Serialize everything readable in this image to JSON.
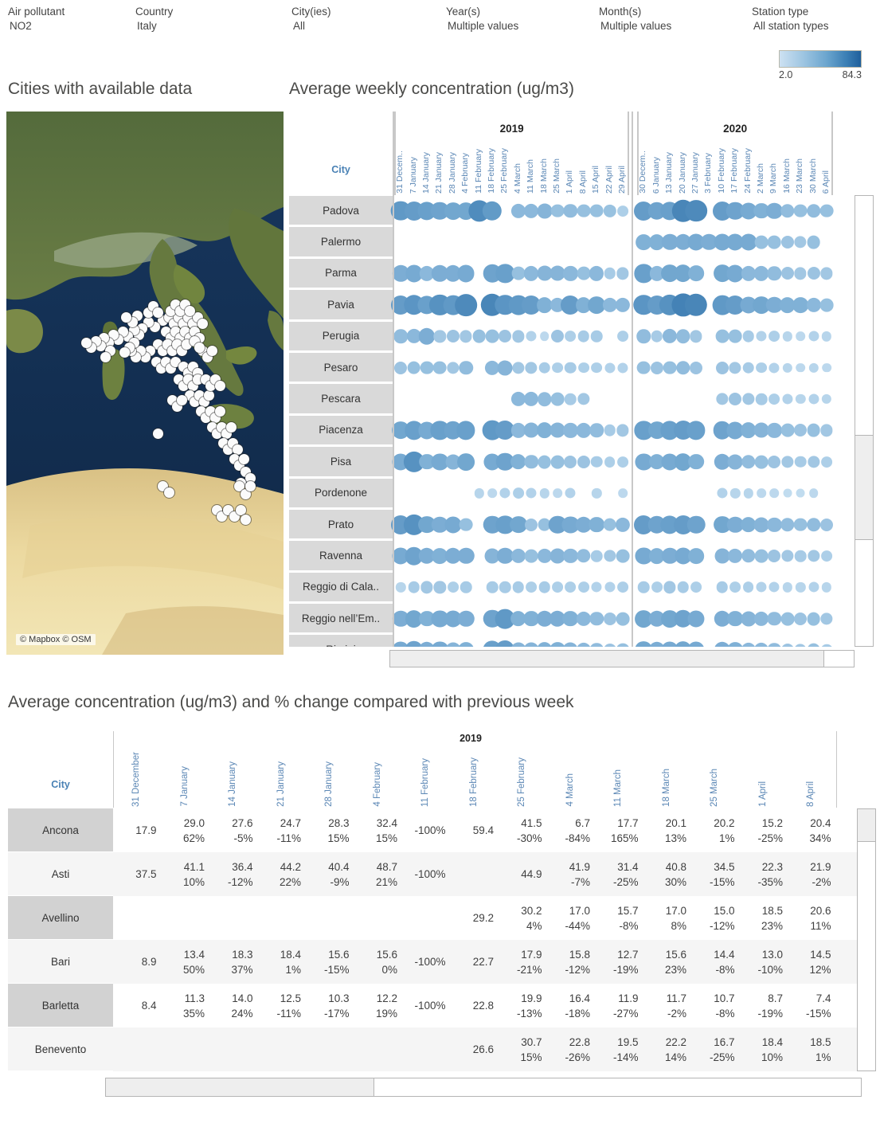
{
  "filters": [
    {
      "label": "Air pollutant",
      "value": "NO2"
    },
    {
      "label": "Country",
      "value": "Italy"
    },
    {
      "label": "City(ies)",
      "value": "All"
    },
    {
      "label": "Year(s)",
      "value": "Multiple values"
    },
    {
      "label": "Month(s)",
      "value": "Multiple values"
    },
    {
      "label": "Station type",
      "value": "All station types"
    }
  ],
  "legend": {
    "min": "2.0",
    "max": "84.3",
    "low_color": "#cde1f2",
    "high_color": "#1f5f9c"
  },
  "map_panel": {
    "title": "Cities with available data",
    "attribution": "© Mapbox © OSM"
  },
  "matrix_panel": {
    "title": "Average weekly concentration  (ug/m3)",
    "city_header": "City",
    "year_groups": [
      {
        "year": "2019",
        "weeks": [
          "31 Decem..",
          "7 January",
          "14 January",
          "21 January",
          "28 January",
          "4 February",
          "11 February",
          "18 February",
          "25 February",
          "4 March",
          "11 March",
          "18 March",
          "25 March",
          "1 April",
          "8 April",
          "15 April",
          "22 April",
          "29 April"
        ]
      },
      {
        "year": "2020",
        "weeks": [
          "30 Decem..",
          "6 January",
          "13 January",
          "20 January",
          "27 January",
          "3 February",
          "10 February",
          "17 February",
          "24 February",
          "2 March",
          "9 March",
          "16 March",
          "23 March",
          "30 March",
          "6 April"
        ]
      }
    ],
    "cities": [
      "Padova",
      "Palermo",
      "Parma",
      "Pavia",
      "Perugia",
      "Pesaro",
      "Pescara",
      "Piacenza",
      "Pisa",
      "Pordenone",
      "Prato",
      "Ravenna",
      "Reggio di Cala..",
      "Reggio nell’Em..",
      "Rimini"
    ],
    "chart_data": {
      "type": "heatmap",
      "title": "Average weekly concentration  (ug/m3)",
      "xlabel": "Week",
      "ylabel": "City",
      "value_unit": "ug/m3",
      "value_range": [
        2.0,
        84.3
      ],
      "legend": "sequential blue, 2.0 to 84.3",
      "rows": [
        {
          "city": "Padova",
          "2019": [
            48,
            46,
            44,
            42,
            40,
            40,
            55,
            47,
            null,
            30,
            30,
            32,
            26,
            28,
            26,
            26,
            25,
            18
          ],
          "2020": [
            46,
            42,
            44,
            58,
            56,
            null,
            46,
            42,
            38,
            34,
            36,
            28,
            26,
            28,
            26
          ]
        },
        {
          "city": "Palermo",
          "2019": [
            null,
            null,
            null,
            null,
            null,
            null,
            null,
            null,
            null,
            null,
            null,
            null,
            null,
            null,
            null,
            null,
            null,
            null
          ],
          "2020": [
            34,
            34,
            36,
            36,
            38,
            36,
            38,
            38,
            38,
            26,
            26,
            24,
            22,
            26,
            null
          ]
        },
        {
          "city": "Parma",
          "2019": [
            36,
            38,
            30,
            36,
            36,
            38,
            null,
            42,
            44,
            26,
            30,
            32,
            32,
            30,
            26,
            30,
            20,
            22
          ],
          "2020": [
            44,
            30,
            40,
            40,
            34,
            null,
            40,
            38,
            30,
            30,
            28,
            24,
            22,
            24,
            22
          ]
        },
        {
          "city": "Pavia",
          "2019": [
            46,
            50,
            44,
            52,
            48,
            56,
            null,
            58,
            50,
            48,
            46,
            34,
            30,
            46,
            34,
            40,
            30,
            30
          ],
          "2020": [
            50,
            46,
            52,
            60,
            58,
            null,
            48,
            46,
            38,
            40,
            36,
            34,
            34,
            30,
            26
          ]
        },
        {
          "city": "Perugia",
          "2019": [
            28,
            30,
            36,
            22,
            24,
            22,
            26,
            26,
            24,
            22,
            16,
            12,
            24,
            18,
            20,
            20,
            null,
            18
          ],
          "2020": [
            28,
            20,
            30,
            28,
            22,
            null,
            26,
            26,
            20,
            16,
            18,
            14,
            12,
            16,
            14
          ]
        },
        {
          "city": "Pesaro",
          "2019": [
            24,
            26,
            26,
            26,
            22,
            28,
            null,
            30,
            32,
            22,
            22,
            20,
            18,
            20,
            18,
            18,
            16,
            16
          ],
          "2020": [
            26,
            24,
            26,
            28,
            24,
            null,
            24,
            22,
            20,
            18,
            16,
            14,
            12,
            14,
            12
          ]
        },
        {
          "city": "Pescara",
          "2019": [
            null,
            null,
            null,
            null,
            null,
            null,
            null,
            null,
            null,
            30,
            30,
            28,
            26,
            20,
            22,
            null,
            null,
            null
          ],
          "2020": [
            null,
            null,
            null,
            null,
            null,
            null,
            22,
            24,
            22,
            20,
            18,
            16,
            14,
            16,
            14
          ]
        },
        {
          "city": "Piacenza",
          "2019": [
            40,
            44,
            38,
            44,
            42,
            44,
            null,
            48,
            46,
            30,
            32,
            34,
            32,
            30,
            30,
            28,
            20,
            22
          ],
          "2020": [
            44,
            40,
            44,
            46,
            44,
            null,
            42,
            38,
            34,
            32,
            30,
            26,
            24,
            26,
            22
          ]
        },
        {
          "city": "Pisa",
          "2019": [
            38,
            52,
            34,
            38,
            32,
            40,
            null,
            38,
            42,
            34,
            28,
            26,
            26,
            24,
            24,
            20,
            18,
            18
          ],
          "2020": [
            38,
            34,
            38,
            40,
            34,
            null,
            36,
            32,
            28,
            26,
            24,
            22,
            20,
            22,
            18
          ]
        },
        {
          "city": "Pordenone",
          "2019": [
            null,
            null,
            null,
            null,
            null,
            null,
            14,
            12,
            16,
            18,
            16,
            14,
            12,
            16,
            null,
            14,
            null,
            12
          ],
          "2020": [
            null,
            null,
            null,
            null,
            null,
            null,
            16,
            14,
            14,
            12,
            12,
            10,
            10,
            12,
            null
          ]
        },
        {
          "city": "Prato",
          "2019": [
            46,
            52,
            40,
            36,
            38,
            26,
            null,
            42,
            44,
            40,
            24,
            26,
            42,
            38,
            36,
            34,
            26,
            30
          ],
          "2020": [
            46,
            42,
            44,
            46,
            42,
            null,
            40,
            36,
            34,
            32,
            30,
            28,
            26,
            28,
            24
          ]
        },
        {
          "city": "Ravenna",
          "2019": [
            38,
            42,
            36,
            34,
            36,
            36,
            null,
            32,
            36,
            30,
            26,
            30,
            32,
            30,
            28,
            20,
            22,
            26
          ],
          "2020": [
            38,
            34,
            36,
            38,
            34,
            null,
            32,
            30,
            28,
            26,
            24,
            22,
            20,
            22,
            18
          ]
        },
        {
          "city": "Reggio di Cala..",
          "2019": [
            14,
            20,
            22,
            22,
            18,
            20,
            null,
            20,
            20,
            20,
            18,
            20,
            18,
            18,
            18,
            16,
            16,
            18
          ],
          "2020": [
            20,
            18,
            22,
            20,
            18,
            null,
            20,
            18,
            18,
            16,
            16,
            14,
            14,
            16,
            14
          ]
        },
        {
          "city": "Reggio nell’Em..",
          "2019": [
            36,
            40,
            34,
            38,
            38,
            36,
            null,
            42,
            48,
            34,
            34,
            36,
            36,
            34,
            30,
            28,
            24,
            26
          ],
          "2020": [
            40,
            36,
            40,
            42,
            38,
            null,
            36,
            34,
            32,
            30,
            28,
            26,
            24,
            26,
            22
          ]
        },
        {
          "city": "Rimini",
          "2019": [
            38,
            42,
            36,
            38,
            32,
            34,
            null,
            44,
            46,
            32,
            32,
            34,
            34,
            32,
            30,
            28,
            24,
            26
          ],
          "2020": [
            40,
            36,
            38,
            40,
            38,
            null,
            36,
            34,
            30,
            30,
            28,
            24,
            22,
            26,
            20
          ]
        }
      ]
    }
  },
  "bottom_panel": {
    "title": "Average concentration (ug/m3) and % change compared with previous week",
    "city_header": "City",
    "year": "2019",
    "columns": [
      "31 December",
      "7 January",
      "14 January",
      "21 January",
      "28 January",
      "4 February",
      "11 February",
      "18 February",
      "25 February",
      "4 March",
      "11 March",
      "18 March",
      "25 March",
      "1 April",
      "8 April"
    ],
    "chart_data": {
      "type": "table",
      "title": "Average concentration (ug/m3) and % change compared with previous week",
      "year": "2019",
      "columns": [
        "31 December",
        "7 January",
        "14 January",
        "21 January",
        "28 January",
        "4 February",
        "11 February",
        "18 February",
        "25 February",
        "4 March",
        "11 March",
        "18 March",
        "25 March",
        "1 April",
        "8 April"
      ],
      "rows": [
        {
          "city": "Ancona",
          "values": [
            "17.9",
            "29.0",
            "27.6",
            "24.7",
            "28.3",
            "32.4",
            "",
            "59.4",
            "41.5",
            "6.7",
            "17.7",
            "20.1",
            "20.2",
            "15.2",
            "20.4"
          ],
          "pct": [
            "",
            "62%",
            "-5%",
            "-11%",
            "15%",
            "15%",
            "-100%",
            "",
            "-30%",
            "-84%",
            "165%",
            "13%",
            "1%",
            "-25%",
            "34%"
          ]
        },
        {
          "city": "Asti",
          "values": [
            "37.5",
            "41.1",
            "36.4",
            "44.2",
            "40.4",
            "48.7",
            "",
            "",
            "44.9",
            "41.9",
            "31.4",
            "40.8",
            "34.5",
            "22.3",
            "21.9"
          ],
          "pct": [
            "",
            "10%",
            "-12%",
            "22%",
            "-9%",
            "21%",
            "-100%",
            "",
            "",
            "-7%",
            "-25%",
            "30%",
            "-15%",
            "-35%",
            "-2%"
          ]
        },
        {
          "city": "Avellino",
          "values": [
            "",
            "",
            "",
            "",
            "",
            "",
            "",
            "29.2",
            "30.2",
            "17.0",
            "15.7",
            "17.0",
            "15.0",
            "18.5",
            "20.6"
          ],
          "pct": [
            "",
            "",
            "",
            "",
            "",
            "",
            "",
            "",
            "4%",
            "-44%",
            "-8%",
            "8%",
            "-12%",
            "23%",
            "11%"
          ]
        },
        {
          "city": "Bari",
          "values": [
            "8.9",
            "13.4",
            "18.3",
            "18.4",
            "15.6",
            "15.6",
            "",
            "22.7",
            "17.9",
            "15.8",
            "12.7",
            "15.6",
            "14.4",
            "13.0",
            "14.5"
          ],
          "pct": [
            "",
            "50%",
            "37%",
            "1%",
            "-15%",
            "0%",
            "-100%",
            "",
            "-21%",
            "-12%",
            "-19%",
            "23%",
            "-8%",
            "-10%",
            "12%"
          ]
        },
        {
          "city": "Barletta",
          "values": [
            "8.4",
            "11.3",
            "14.0",
            "12.5",
            "10.3",
            "12.2",
            "",
            "22.8",
            "19.9",
            "16.4",
            "11.9",
            "11.7",
            "10.7",
            "8.7",
            "7.4"
          ],
          "pct": [
            "",
            "35%",
            "24%",
            "-11%",
            "-17%",
            "19%",
            "-100%",
            "",
            "-13%",
            "-18%",
            "-27%",
            "-2%",
            "-8%",
            "-19%",
            "-15%"
          ]
        },
        {
          "city": "Benevento",
          "values": [
            "",
            "",
            "",
            "",
            "",
            "",
            "",
            "26.6",
            "30.7",
            "22.8",
            "19.5",
            "22.2",
            "16.7",
            "18.4",
            "18.5"
          ],
          "pct": [
            "",
            "",
            "",
            "",
            "",
            "",
            "",
            "",
            "15%",
            "-26%",
            "-14%",
            "14%",
            "-25%",
            "10%",
            "1%"
          ]
        }
      ]
    }
  }
}
